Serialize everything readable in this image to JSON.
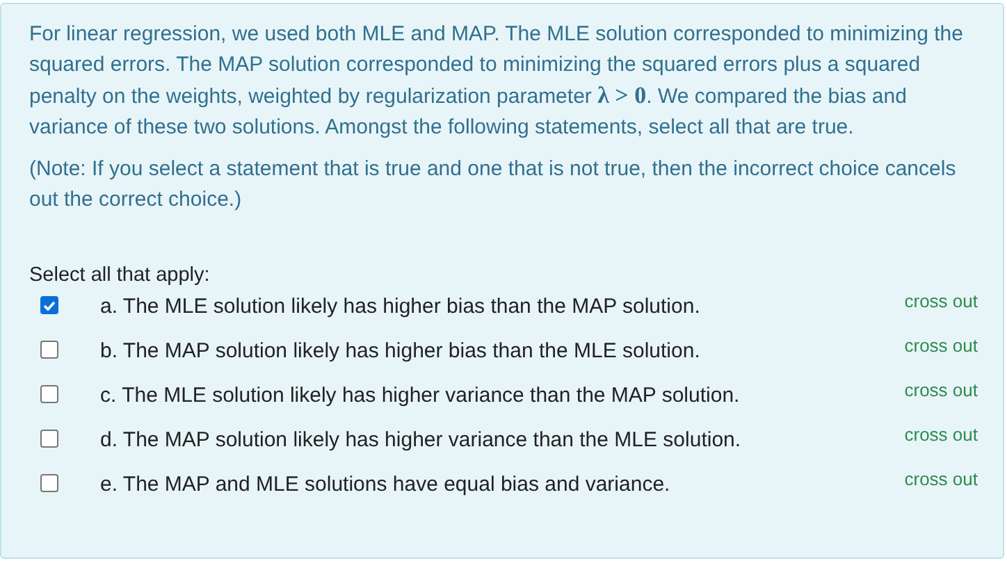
{
  "question": {
    "text": "For linear regression, we used both MLE and MAP. The MLE solution corresponded to minimizing the squared errors. The MAP solution corresponded to minimizing the squared errors plus a squared penalty on the weights, weighted by regularization parameter **λ > 0**. We compared the bias and variance of these two solutions. Amongst the following statements, select all that are true.",
    "note": "(Note: If you select a statement that is true and one that is not true, then the incorrect choice cancels out the correct choice.)"
  },
  "prompt": "Select all that apply:",
  "options": [
    {
      "label": "a. The MLE solution likely has higher bias than the MAP solution.",
      "checked": true,
      "action": "cross out"
    },
    {
      "label": "b. The MAP solution likely has higher bias than the MLE solution.",
      "checked": false,
      "action": "cross out"
    },
    {
      "label": "c. The MLE solution likely has higher variance than the MAP solution.",
      "checked": false,
      "action": "cross out"
    },
    {
      "label": "d. The MAP solution likely has higher variance than the MLE solution.",
      "checked": false,
      "action": "cross out"
    },
    {
      "label": "e. The MAP and MLE solutions have equal bias and variance.",
      "checked": false,
      "action": "cross out"
    }
  ]
}
